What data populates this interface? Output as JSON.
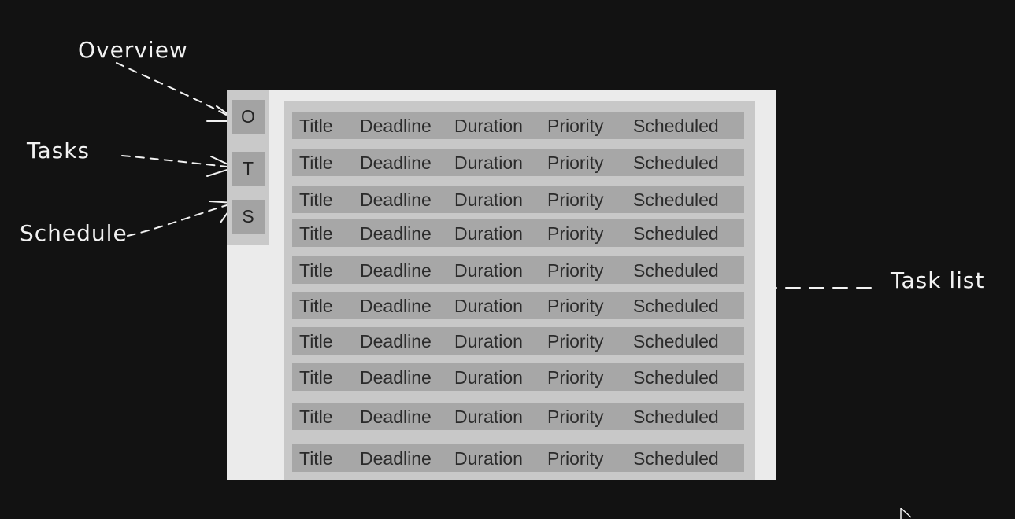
{
  "annotations": {
    "overview": "Overview",
    "tasks": "Tasks",
    "schedule": "Schedule",
    "task_list": "Task list"
  },
  "sidebar": {
    "buttons": [
      {
        "label": "O"
      },
      {
        "label": "T"
      },
      {
        "label": "S"
      }
    ]
  },
  "task_list": {
    "rows": [
      {
        "title": "Title",
        "deadline": "Deadline",
        "duration": "Duration",
        "priority": "Priority",
        "scheduled": "Scheduled"
      },
      {
        "title": "Title",
        "deadline": "Deadline",
        "duration": "Duration",
        "priority": "Priority",
        "scheduled": "Scheduled"
      },
      {
        "title": "Title",
        "deadline": "Deadline",
        "duration": "Duration",
        "priority": "Priority",
        "scheduled": "Scheduled"
      },
      {
        "title": "Title",
        "deadline": "Deadline",
        "duration": "Duration",
        "priority": "Priority",
        "scheduled": "Scheduled"
      },
      {
        "title": "Title",
        "deadline": "Deadline",
        "duration": "Duration",
        "priority": "Priority",
        "scheduled": "Scheduled"
      },
      {
        "title": "Title",
        "deadline": "Deadline",
        "duration": "Duration",
        "priority": "Priority",
        "scheduled": "Scheduled"
      },
      {
        "title": "Title",
        "deadline": "Deadline",
        "duration": "Duration",
        "priority": "Priority",
        "scheduled": "Scheduled"
      },
      {
        "title": "Title",
        "deadline": "Deadline",
        "duration": "Duration",
        "priority": "Priority",
        "scheduled": "Scheduled"
      },
      {
        "title": "Title",
        "deadline": "Deadline",
        "duration": "Duration",
        "priority": "Priority",
        "scheduled": "Scheduled"
      },
      {
        "title": "Title",
        "deadline": "Deadline",
        "duration": "Duration",
        "priority": "Priority",
        "scheduled": "Scheduled"
      }
    ]
  },
  "colors": {
    "background": "#121212",
    "frame": "#ebebeb",
    "panel": "#c8c8c8",
    "row": "#a7a7a7",
    "annotation": "#f2f2f2"
  },
  "icons": {
    "cursor": "mouse-pointer-icon"
  }
}
